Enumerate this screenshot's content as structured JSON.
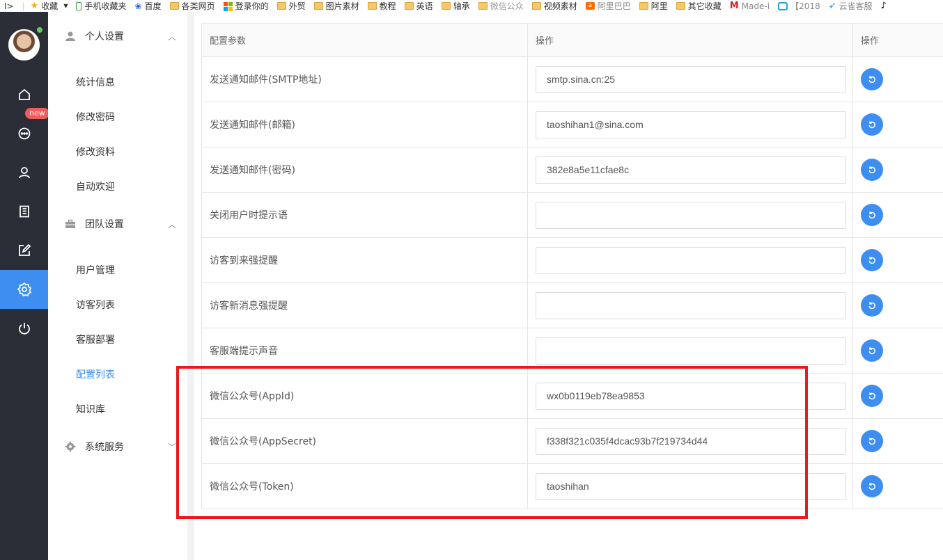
{
  "bookmarks": [
    {
      "label": "收藏",
      "icon": "star-icon"
    },
    {
      "label": "手机收藏夹",
      "icon": "phone-icon"
    },
    {
      "label": "百度",
      "icon": "baidu-paw-icon"
    },
    {
      "label": "各类网页",
      "icon": "folder-icon"
    },
    {
      "label": "登录你的",
      "icon": "windows-icon"
    },
    {
      "label": "外贸",
      "icon": "folder-icon"
    },
    {
      "label": "图片素材",
      "icon": "folder-icon"
    },
    {
      "label": "教程",
      "icon": "folder-icon"
    },
    {
      "label": "英语",
      "icon": "folder-icon"
    },
    {
      "label": "轴承",
      "icon": "folder-icon"
    },
    {
      "label": "微信公众",
      "icon": "folder-icon"
    },
    {
      "label": "视频素材",
      "icon": "folder-icon"
    },
    {
      "label": "阿里巴巴",
      "icon": "alibaba-icon"
    },
    {
      "label": "阿里",
      "icon": "folder-icon"
    },
    {
      "label": "其它收藏",
      "icon": "folder-icon"
    },
    {
      "label": "Made-i",
      "icon": "made-in-china-icon"
    },
    {
      "label": "【2018",
      "icon": "bilibili-tv-icon"
    },
    {
      "label": "云雀客服",
      "icon": "bird-icon"
    },
    {
      "label": "",
      "icon": "tiktok-icon"
    }
  ],
  "rail": {
    "new_badge": "new",
    "items": [
      "home-icon",
      "chat-icon",
      "user-icon",
      "book-icon",
      "edit-icon",
      "settings-icon",
      "power-icon"
    ]
  },
  "subnav": {
    "group_personal": "个人设置",
    "personal_items": [
      "统计信息",
      "修改密码",
      "修改资料",
      "自动欢迎"
    ],
    "group_team": "团队设置",
    "team_items": [
      "用户管理",
      "访客列表",
      "客服部署",
      "配置列表",
      "知识库"
    ],
    "group_system": "系统服务"
  },
  "table": {
    "headers": [
      "配置参数",
      "操作",
      "操作"
    ],
    "rows": [
      {
        "label": "发送通知邮件(SMTP地址)",
        "value": "smtp.sina.cn:25"
      },
      {
        "label": "发送通知邮件(邮箱)",
        "value": "taoshihan1@sina.com"
      },
      {
        "label": "发送通知邮件(密码)",
        "value": "382e8a5e11cfae8c"
      },
      {
        "label": "关闭用户时提示语",
        "value": ""
      },
      {
        "label": "访客到来强提醒",
        "value": ""
      },
      {
        "label": "访客新消息强提醒",
        "value": ""
      },
      {
        "label": "客服端提示声音",
        "value": ""
      },
      {
        "label": "微信公众号(AppId)",
        "value": "wx0b0119eb78ea9853"
      },
      {
        "label": "微信公众号(AppSecret)",
        "value": "f338f321c035f4dcac93b7f219734d44"
      },
      {
        "label": "微信公众号(Token)",
        "value": "taoshihan"
      }
    ]
  },
  "colors": {
    "accent": "#3d8ef0",
    "rail_bg": "#2b2d37",
    "highlight_box": "#e81b1b",
    "badge": "#f25b5b"
  }
}
